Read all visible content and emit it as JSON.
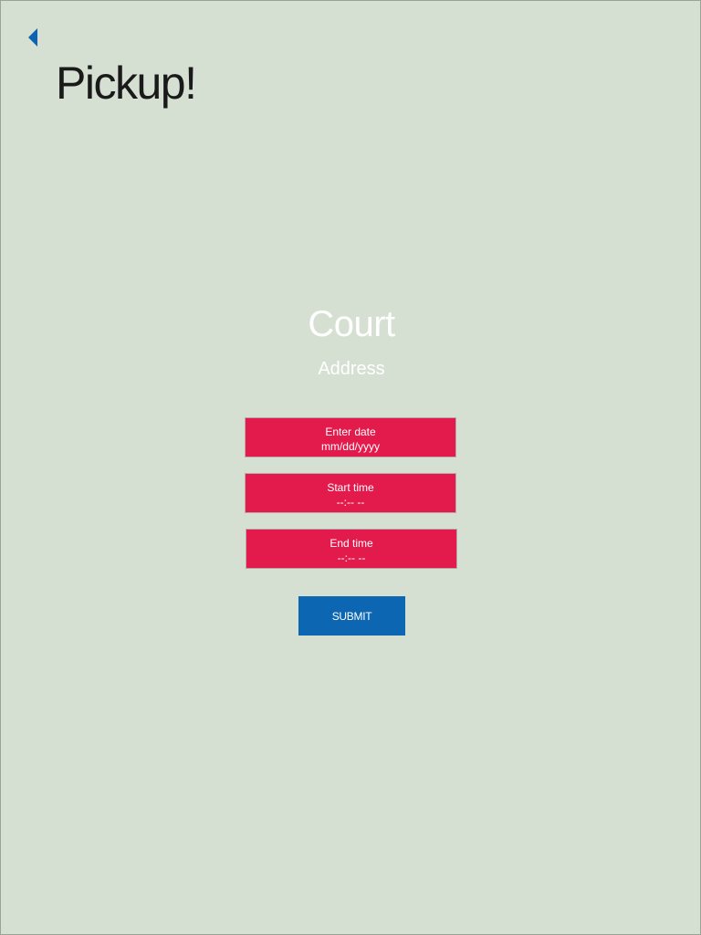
{
  "header": {
    "back_icon": "chevron-left-icon",
    "title": "Pickup!"
  },
  "court": {
    "name": "Court",
    "address": "Address"
  },
  "form": {
    "date": {
      "label": "Enter date",
      "value": "mm/dd/yyyy"
    },
    "start_time": {
      "label": "Start time",
      "value": "--:-- --"
    },
    "end_time": {
      "label": "End time",
      "value": "--:-- --"
    },
    "submit_label": "SUBMIT"
  },
  "colors": {
    "background": "#d6e0d2",
    "field": "#e31b4c",
    "accent": "#0c66b1",
    "title_text": "#1a1a1a",
    "light_text": "#ffffff"
  }
}
